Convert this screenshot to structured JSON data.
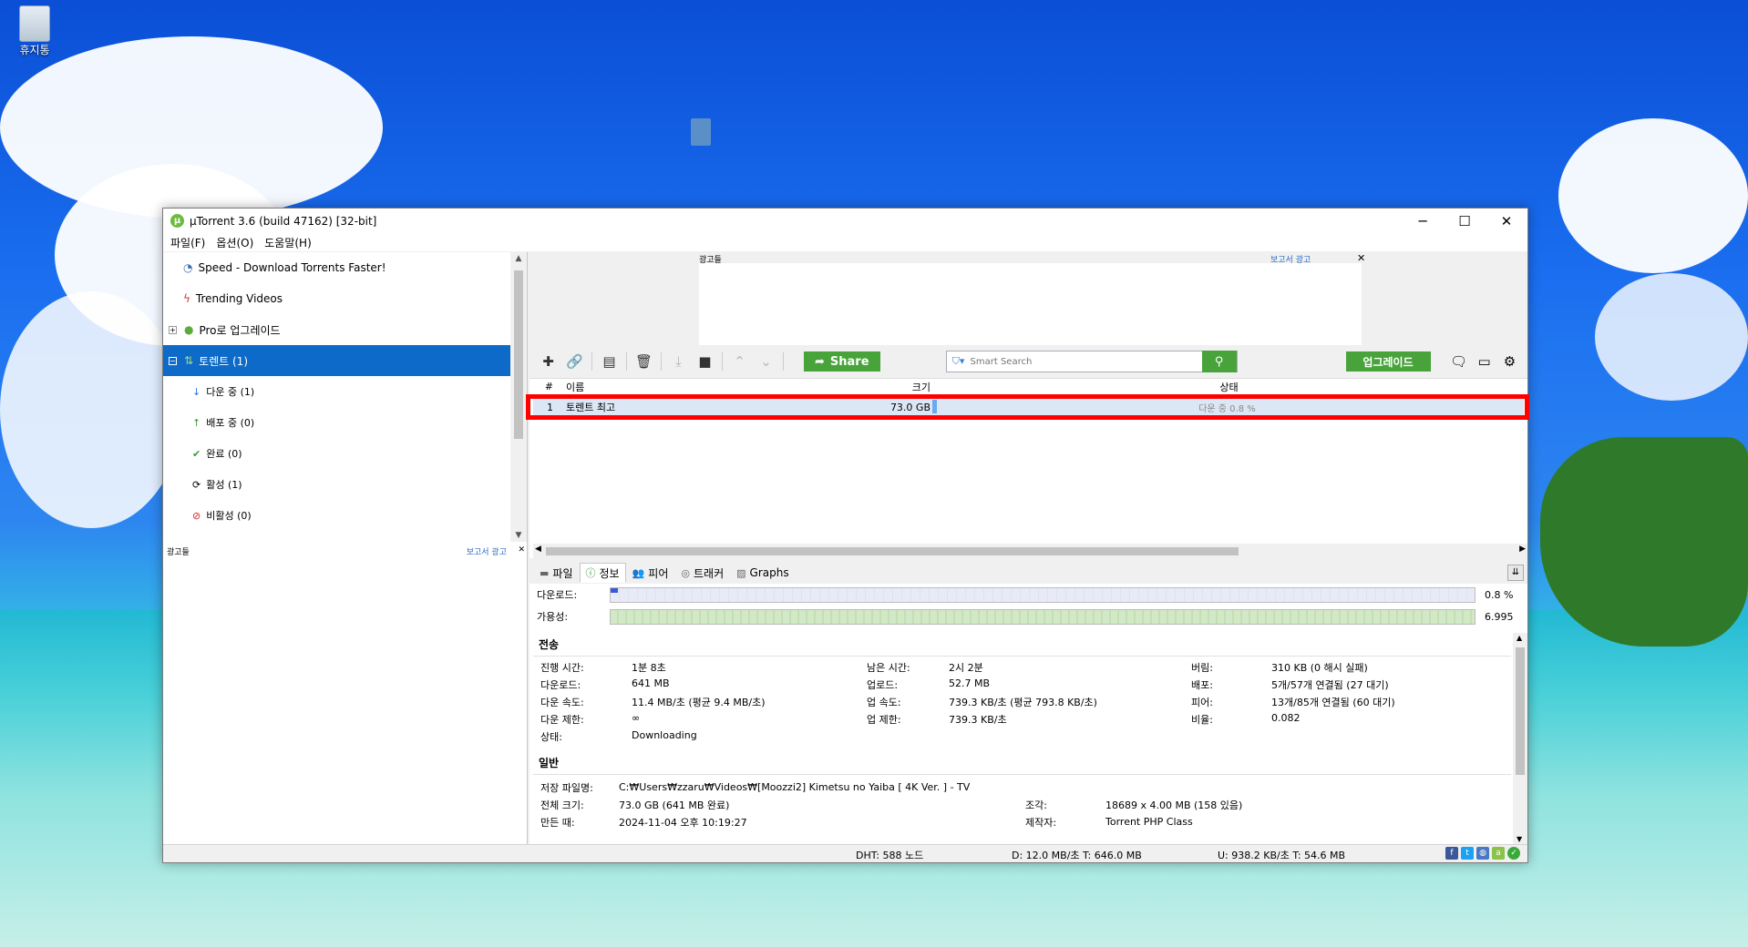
{
  "desktop": {
    "recycle_bin_label": "휴지통"
  },
  "window": {
    "title": "µTorrent 3.6  (build 47162) [32-bit]",
    "menu": [
      "파일(F)",
      "옵션(O)",
      "도움말(H)"
    ]
  },
  "sidebar": {
    "items": [
      {
        "label": "Speed - Download Torrents Faster!",
        "icon": "speed-icon"
      },
      {
        "label": "Trending Videos",
        "icon": "lightning-icon"
      },
      {
        "label": "Pro로 업그레이드",
        "icon": "utorrent-logo-icon"
      },
      {
        "label": "토렌트 (1)",
        "icon": "torrent-icon"
      }
    ],
    "subitems": [
      {
        "label": "다운 중 (1)",
        "icon": "download-arrow-icon"
      },
      {
        "label": "배포 중 (0)",
        "icon": "upload-arrow-icon"
      },
      {
        "label": "완료 (0)",
        "icon": "checkmark-icon"
      },
      {
        "label": "활성 (1)",
        "icon": "refresh-icon"
      },
      {
        "label": "비활성 (0)",
        "icon": "inactive-icon"
      }
    ],
    "ad_label": "광고들",
    "ad_link": "보고서 광고"
  },
  "ad_top": {
    "label": "광고들",
    "link": "보고서 광고"
  },
  "toolbar": {
    "share_label": "Share",
    "search_placeholder": "Smart Search",
    "upgrade_label": "업그레이드"
  },
  "list": {
    "headers": {
      "num": "#",
      "name": "이름",
      "size": "크기",
      "status": "상태"
    },
    "rows": [
      {
        "num": "1",
        "name": "토렌트 최고",
        "size": "73.0 GB",
        "status": "다운 중 0.8 %",
        "progress": 0.008
      }
    ]
  },
  "tabs": [
    {
      "label": "파일",
      "icon": "folder-icon"
    },
    {
      "label": "정보",
      "icon": "info-icon"
    },
    {
      "label": "피어",
      "icon": "peers-icon"
    },
    {
      "label": "트래커",
      "icon": "tracker-icon"
    },
    {
      "label": "Graphs",
      "icon": "graph-icon"
    }
  ],
  "info": {
    "download_label": "다운로드:",
    "download_value": "0.8 %",
    "download_progress": 0.008,
    "availability_label": "가용성:",
    "availability_value": "6.995",
    "transfer_title": "전송",
    "transfer": [
      [
        "진행 시간:",
        "1분 8초",
        "남은 시간:",
        "2시 2분",
        "버림:",
        "310 KB (0 해시 실패)"
      ],
      [
        "다운로드:",
        "641 MB",
        "업로드:",
        "52.7 MB",
        "배포:",
        "5개/57개 연결됨 (27 대기)"
      ],
      [
        "다운 속도:",
        "11.4 MB/초 (평균 9.4 MB/초)",
        "업 속도:",
        "739.3 KB/초 (평균 793.8 KB/초)",
        "피어:",
        "13개/85개 연결됨 (60 대기)"
      ],
      [
        "다운 제한:",
        "∞",
        "업 제한:",
        "739.3 KB/초",
        "비율:",
        "0.082"
      ],
      [
        "상태:",
        "Downloading",
        "",
        "",
        "",
        ""
      ]
    ],
    "general_title": "일반",
    "general": {
      "save_path_label": "저장 파일명:",
      "save_path": "C:₩Users₩zzaru₩Videos₩[Moozzi2] Kimetsu no Yaiba [ 4K Ver. ] - TV",
      "total_size_label": "전체 크기:",
      "total_size": "73.0 GB (641 MB 완료)",
      "pieces_label": "조각:",
      "pieces": "18689 x 4.00 MB (158 있음)",
      "created_label": "만든 때:",
      "created": "2024-11-04 오후 10:19:27",
      "creator_label": "제작자:",
      "creator": "Torrent PHP Class"
    }
  },
  "statusbar": {
    "dht": "DHT: 588 노드",
    "down": "D: 12.0 MB/초 T: 646.0 MB",
    "up": "U: 938.2 KB/초 T: 54.6 MB"
  },
  "colors": {
    "accent_green": "#49a33b",
    "selection_blue": "#0e6ac8",
    "highlight_red": "#ff0000"
  }
}
